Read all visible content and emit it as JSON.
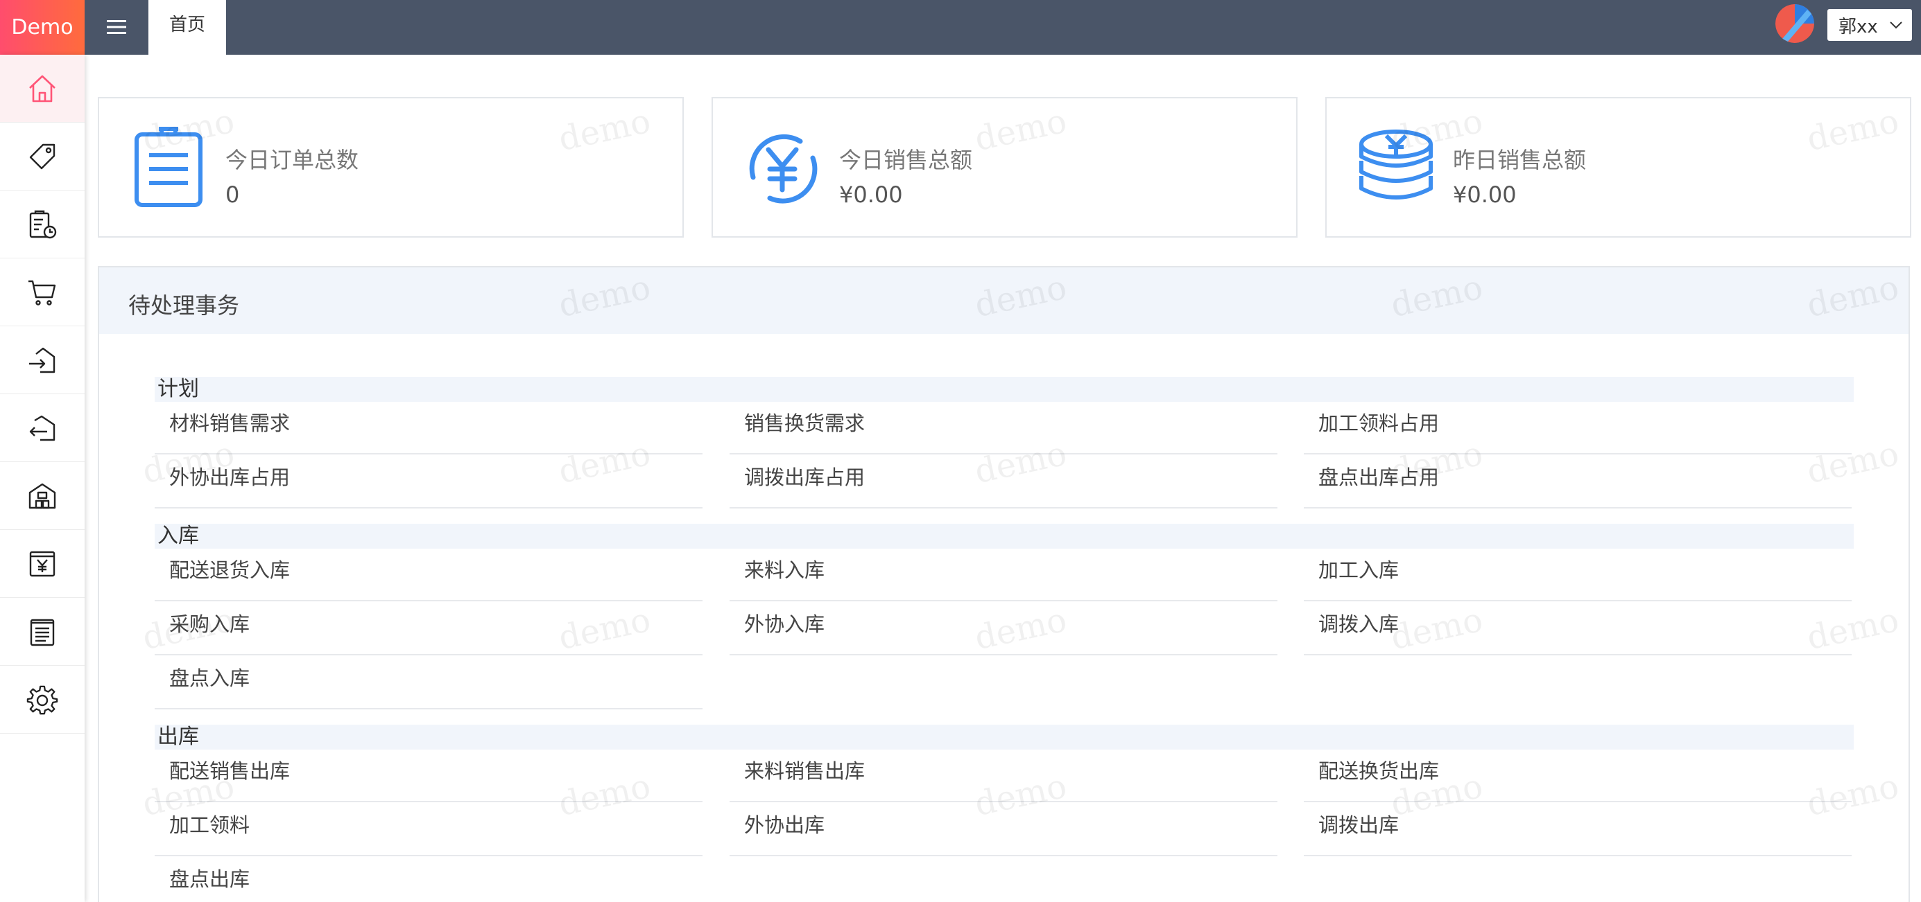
{
  "header": {
    "logo": "Demo",
    "active_tab": "首页",
    "user_name": "郭xx"
  },
  "sidebar": {
    "items": [
      {
        "icon": "home-icon"
      },
      {
        "icon": "tag-icon"
      },
      {
        "icon": "clipboard-clock-icon"
      },
      {
        "icon": "cart-icon"
      },
      {
        "icon": "inbound-icon"
      },
      {
        "icon": "outbound-icon"
      },
      {
        "icon": "warehouse-icon"
      },
      {
        "icon": "yen-box-icon"
      },
      {
        "icon": "report-icon"
      },
      {
        "icon": "gear-icon"
      }
    ]
  },
  "stats": [
    {
      "label": "今日订单总数",
      "value": "0",
      "icon": "clipboard-icon"
    },
    {
      "label": "今日销售总额",
      "value": "¥0.00",
      "icon": "yen-circle-icon"
    },
    {
      "label": "昨日销售总额",
      "value": "¥0.00",
      "icon": "yen-coins-icon"
    }
  ],
  "pending": {
    "title": "待处理事务",
    "groups": [
      {
        "title": "计划",
        "items": [
          "材料销售需求",
          "销售换货需求",
          "加工领料占用",
          "外协出库占用",
          "调拨出库占用",
          "盘点出库占用"
        ]
      },
      {
        "title": "入库",
        "items": [
          "配送退货入库",
          "来料入库",
          "加工入库",
          "采购入库",
          "外协入库",
          "调拨入库",
          "盘点入库"
        ]
      },
      {
        "title": "出库",
        "items": [
          "配送销售出库",
          "来料销售出库",
          "配送换货出库",
          "加工领料",
          "外协出库",
          "调拨出库",
          "盘点出库"
        ]
      }
    ]
  },
  "watermark": "demo",
  "colors": {
    "accent": "#ff4d6d",
    "header_bg": "#4a5568",
    "icon_blue": "#3d8ef0"
  }
}
